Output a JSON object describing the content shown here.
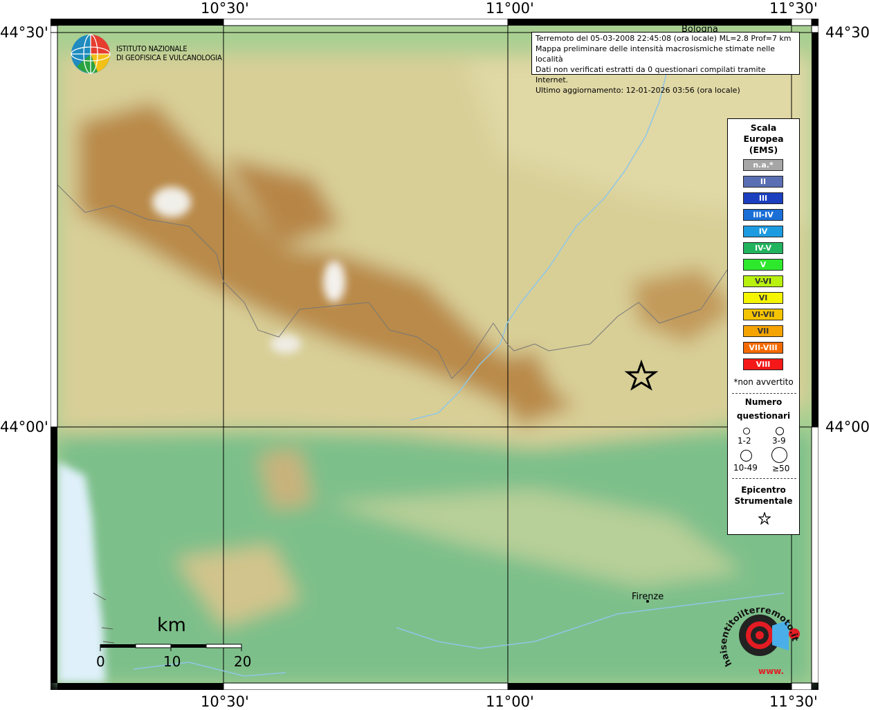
{
  "coords": {
    "top_left": "10°30'",
    "top_mid": "11°00'",
    "top_right": "11°30'",
    "bottom_left": "10°30'",
    "bottom_mid": "11°00'",
    "bottom_right": "11°30'",
    "left_top": "44°30'",
    "left_mid": "44°00'",
    "right_top": "44°30'",
    "right_mid": "44°00'"
  },
  "logo": {
    "line1": "ISTITUTO NAZIONALE",
    "line2": "DI GEOFISICA E VULCANOLOGIA"
  },
  "info": {
    "line1": "Terremoto del 05-03-2008 22:45:08 (ora locale) ML=2.8 Prof=7 km",
    "line2": "Mappa preliminare delle intensità macrosismiche stimate nelle località",
    "line3": "Dati non verificati estratti da 0 questionari compilati tramite Internet.",
    "line4": "Ultimo aggiornamento: 12-01-2026 03:56 (ora locale)"
  },
  "cities": {
    "bologna": "Bologna",
    "firenze": "Firenze"
  },
  "scale": {
    "unit": "km",
    "ticks": [
      "0",
      "10",
      "20"
    ]
  },
  "legend": {
    "title_line1": "Scala",
    "title_line2": "Europea",
    "title_line3": "(EMS)",
    "items": [
      {
        "label": "n.a.*",
        "color": "#a6a6a6"
      },
      {
        "label": "II",
        "color": "#5a6fb3"
      },
      {
        "label": "III",
        "color": "#1b3fbf"
      },
      {
        "label": "III-IV",
        "color": "#1a6fd6"
      },
      {
        "label": "IV",
        "color": "#1d9be0"
      },
      {
        "label": "IV-V",
        "color": "#22b35e"
      },
      {
        "label": "V",
        "color": "#2ee82e"
      },
      {
        "label": "V-VI",
        "color": "#b8f010"
      },
      {
        "label": "VI",
        "color": "#f5f500"
      },
      {
        "label": "VI-VII",
        "color": "#f5c400"
      },
      {
        "label": "VII",
        "color": "#f5a300"
      },
      {
        "label": "VII-VIII",
        "color": "#f56a00"
      },
      {
        "label": "VIII",
        "color": "#f51818"
      }
    ],
    "not_felt": "*non avvertito",
    "num_title1": "Numero",
    "num_title2": "questionari",
    "num_labels": [
      "1-2",
      "3-9",
      "10-49",
      "≥50"
    ],
    "epi_title1": "Epicentro",
    "epi_title2": "Strumentale"
  },
  "watermark": {
    "text1": "haisentitoilterremoto.it",
    "text2": "www.",
    "icon": "seismograph-target-icon"
  },
  "colors": {
    "lowland": "#7cc08a",
    "hills": "#d9cf98",
    "mountains": "#b98a4a",
    "peaks": "#eeeeee",
    "sea": "#dff0fa",
    "river": "#8fc6e6",
    "epicenter_star": "#000000"
  }
}
